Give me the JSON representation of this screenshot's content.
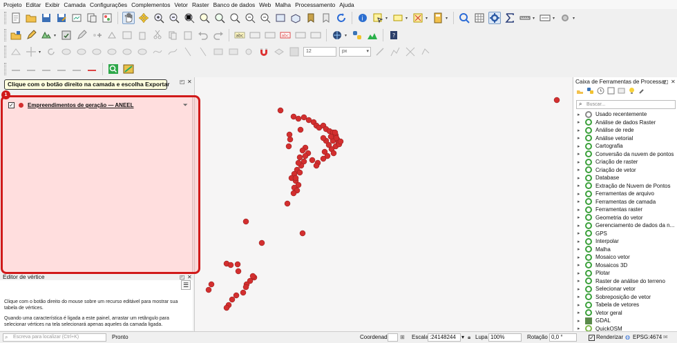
{
  "menu": [
    "Projeto",
    "Editar",
    "Exibir",
    "Camada",
    "Configurações",
    "Complementos",
    "Vetor",
    "Raster",
    "Banco de dados",
    "Web",
    "Malha",
    "Processamento",
    "Ajuda"
  ],
  "toolbar": {
    "font_size_value": "12",
    "font_unit": "px"
  },
  "layers_panel": {
    "tooltip": "Clique com o botão direito na camada e escolha Exportar",
    "step_badge": "1",
    "layer": {
      "name": "Empreendimentos de geração — ANEEL",
      "checked": "✓",
      "color": "#d32f2f"
    },
    "highlight_color": "#d01919"
  },
  "vertex_editor": {
    "title": "Editor de vértice",
    "menu_glyph": "☰",
    "text1": "Clique com o botão direito do mouse sobre um recurso editável para mostrar sua tabela de vértices.",
    "text2": "Quando uma característica é ligada a este painel, arrastar um retângulo para selecionar vértices na tela selecionará apenas aqueles da camada ligada."
  },
  "toolbox": {
    "title": "Caixa de Ferramentas de Processam...",
    "search_placeholder": "Buscar...",
    "items": [
      {
        "label": "Usado recentemente",
        "icon": "clock-icon"
      },
      {
        "label": "Análise de dados Raster",
        "icon": "qgis-icon"
      },
      {
        "label": "Análise de rede",
        "icon": "qgis-icon"
      },
      {
        "label": "Análise vetorial",
        "icon": "qgis-icon"
      },
      {
        "label": "Cartografia",
        "icon": "qgis-icon"
      },
      {
        "label": "Conversão da nuvem de pontos",
        "icon": "qgis-icon"
      },
      {
        "label": "Criação de raster",
        "icon": "qgis-icon"
      },
      {
        "label": "Criação de vetor",
        "icon": "qgis-icon"
      },
      {
        "label": "Database",
        "icon": "qgis-icon"
      },
      {
        "label": "Extração de Nuvem de Pontos",
        "icon": "qgis-icon"
      },
      {
        "label": "Ferramentas de arquivo",
        "icon": "qgis-icon"
      },
      {
        "label": "Ferramentas de camada",
        "icon": "qgis-icon"
      },
      {
        "label": "Ferramentas raster",
        "icon": "qgis-icon"
      },
      {
        "label": "Geometria do vetor",
        "icon": "qgis-icon"
      },
      {
        "label": "Gerenciamento de dados da n...",
        "icon": "qgis-icon"
      },
      {
        "label": "GPS",
        "icon": "qgis-icon"
      },
      {
        "label": "Interpolar",
        "icon": "qgis-icon"
      },
      {
        "label": "Malha",
        "icon": "qgis-icon"
      },
      {
        "label": "Mosaico vetor",
        "icon": "qgis-icon"
      },
      {
        "label": "Mosaicos 3D",
        "icon": "qgis-icon"
      },
      {
        "label": "Plotar",
        "icon": "qgis-icon"
      },
      {
        "label": "Raster de análise do terreno",
        "icon": "qgis-icon"
      },
      {
        "label": "Selecionar vetor",
        "icon": "qgis-icon"
      },
      {
        "label": "Sobreposição de vetor",
        "icon": "qgis-icon"
      },
      {
        "label": "Tabela de vetores",
        "icon": "qgis-icon"
      },
      {
        "label": "Vetor geral",
        "icon": "qgis-icon"
      },
      {
        "label": "GDAL",
        "icon": "gdal-icon"
      },
      {
        "label": "QuickOSM",
        "icon": "quickosm-icon"
      }
    ]
  },
  "statusbar": {
    "locator_placeholder": "Escreva para localizar (Ctrl+K)",
    "status": "Pronto",
    "coordinate_label": "Coordenada",
    "scale_label": "Escala",
    "scale_value": ":24148244",
    "magnifier_label": "Lupa",
    "magnifier_value": "100%",
    "rotation_label": "Rotação",
    "rotation_value": "0,0 °",
    "render_label": "Renderizar",
    "crs_label": "EPSG:4674"
  },
  "map": {
    "point_color": "#d32f2f"
  }
}
